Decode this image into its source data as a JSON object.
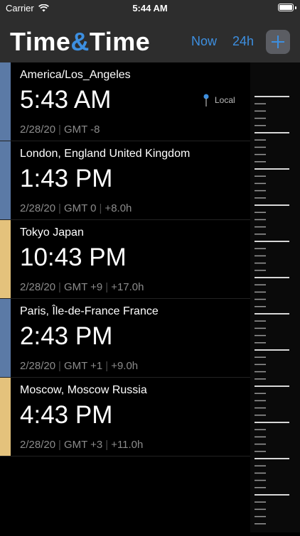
{
  "status": {
    "carrier": "Carrier",
    "time": "5:44 AM"
  },
  "nav": {
    "title_part1": "Time",
    "title_amp": "&",
    "title_part2": "Time",
    "now_label": "Now",
    "h24_label": "24h"
  },
  "colors": {
    "accent": "#3d8fe0",
    "blue_bar": "#5b7aa6",
    "gold_bar": "#e4c27c"
  },
  "local_label": "Local",
  "zones": [
    {
      "name": "America/Los_Angeles",
      "time": "5:43 AM",
      "date": "2/28/20",
      "gmt": "GMT -8",
      "offset": ""
    },
    {
      "name": "London, England United Kingdom",
      "time": "1:43 PM",
      "date": "2/28/20",
      "gmt": "GMT 0",
      "offset": "+8.0h"
    },
    {
      "name": "Tokyo Japan",
      "time": "10:43 PM",
      "date": "2/28/20",
      "gmt": "GMT +9",
      "offset": "+17.0h"
    },
    {
      "name": "Paris, Île-de-France France",
      "time": "2:43 PM",
      "date": "2/28/20",
      "gmt": "GMT +1",
      "offset": "+9.0h"
    },
    {
      "name": "Moscow, Moscow Russia",
      "time": "4:43 PM",
      "date": "2/28/20",
      "gmt": "GMT +3",
      "offset": "+11.0h"
    }
  ]
}
